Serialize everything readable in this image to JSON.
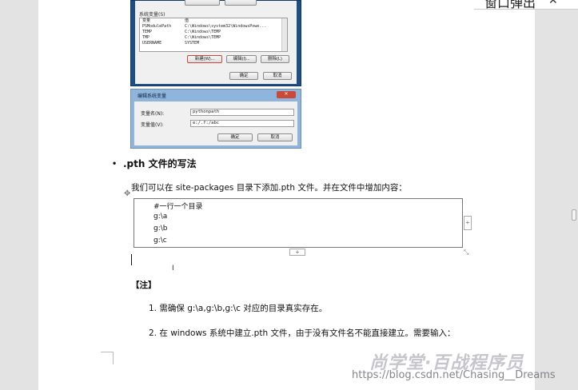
{
  "popout": {
    "label": "窗口弹出",
    "close_icon": "✕"
  },
  "dialog_upper": {
    "top_buttons": [
      "",
      ""
    ],
    "system_vars_label": "系统变量(S)",
    "table_headers": [
      "变量",
      "值"
    ],
    "rows": [
      [
        "PSModulePath",
        "C:\\Windows\\system32\\WindowsPowe..."
      ],
      [
        "TEMP",
        "C:\\Windows\\TEMP"
      ],
      [
        "TMP",
        "C:\\Windows\\TEMP"
      ],
      [
        "USERNAME",
        "SYSTEM"
      ]
    ],
    "new_button": "新建(W)...",
    "edit_button": "编辑(I)...",
    "delete_button": "删除(L)",
    "ok_button": "确定",
    "cancel_button": "取消"
  },
  "dialog_lower": {
    "title": "编辑系统变量",
    "close_icon": "✕",
    "name_label": "变量名(N):",
    "name_value": "pythonpath",
    "value_label": "变量值(V):",
    "value_value": "e:/.f:/abc",
    "ok_button": "确定",
    "cancel_button": "取消"
  },
  "doc": {
    "bullet": "•",
    "heading": ".pth 文件的写法",
    "paragraph": "我们可以在 site-packages 目录下添加.pth 文件。并在文件中增加内容：",
    "code_lines": [
      "#一行一个目录",
      "g:\\a",
      "g:\\b",
      "g:\\c"
    ],
    "note": "【注】",
    "items": [
      "1. 需确保 g:\\a,g:\\b,g:\\c 对应的目录真实存在。",
      "2. 在 windows 系统中建立.pth 文件，由于没有文件名不能直接建立。需要输入："
    ]
  },
  "watermark": {
    "brand": "尚学堂·百战程序员",
    "url": "https://blog.csdn.net/Chasing__Dreams"
  }
}
